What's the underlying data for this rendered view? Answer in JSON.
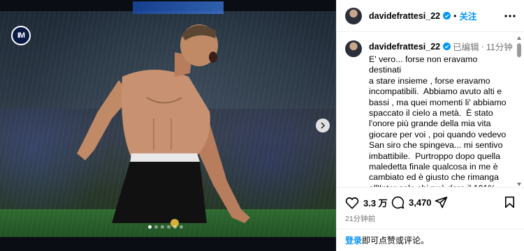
{
  "post": {
    "media": {
      "slide_count": 6,
      "active_slide": 1,
      "club_logo_text": "IM",
      "next_icon": "chevron-right-icon"
    },
    "header": {
      "username": "davidefrattesi_22",
      "separator": "•",
      "follow_label": "关注",
      "more_icon": "ellipsis-icon"
    },
    "caption": {
      "username": "davidefrattesi_22",
      "edited_label": "已编辑",
      "separator": "·",
      "time": "11分钟",
      "text": "E' vero... forse non eravamo destinati\na stare insieme , forse eravamo\nincompatibili.  Abbiamo avuto alti e\nbassi , ma quei momenti li' abbiamo\nspaccato il cielo a metà.  È stato\nl'onore più grande della mia vita\ngiocare per voi , poi quando vedevo\nSan siro che spingeva... mi sentivo\nimbattibile.  Purtroppo dopo quella\nmaledetta finale qualcosa in me è\ncambiato ed è giusto che rimanga\nall'Inter solo chi può dare il 101%.  Vi\nho voluto bene come fratelli e sorelle\n, sarò sempre il vostro primo tifoso"
    },
    "actions": {
      "likes": "3.3 万",
      "comments": "3,470",
      "like_icon": "heart-icon",
      "comment_icon": "comment-icon",
      "share_icon": "share-icon",
      "save_icon": "bookmark-icon"
    },
    "posted_time": "21分钟前",
    "login": {
      "link_label": "登录",
      "rest_label": "即可点赞或评论。"
    }
  },
  "colors": {
    "accent_blue": "#0095f6",
    "muted_text": "#737373",
    "divider": "#efefef",
    "verified_blue": "#0095f6"
  }
}
